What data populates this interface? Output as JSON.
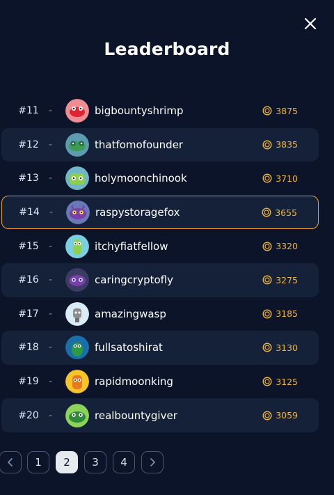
{
  "modal": {
    "title": "Leaderboard"
  },
  "colors": {
    "background": "#0b1428",
    "row_alt": "#152039",
    "highlight": "#f0a12a",
    "score": "#f2b63a"
  },
  "icons": {
    "close": "close-icon",
    "coin": "coin-icon",
    "prev": "chevron-left-icon",
    "next": "chevron-right-icon"
  },
  "entries": [
    {
      "rank": "#11",
      "dash": "-",
      "name": "bigbountyshrimp",
      "score": "3875"
    },
    {
      "rank": "#12",
      "dash": "-",
      "name": "thatfomofounder",
      "score": "3835"
    },
    {
      "rank": "#13",
      "dash": "-",
      "name": "holymoonchinook",
      "score": "3710"
    },
    {
      "rank": "#14",
      "dash": "-",
      "name": "raspystoragefox",
      "score": "3655"
    },
    {
      "rank": "#15",
      "dash": "-",
      "name": "itchyfiatfellow",
      "score": "3320"
    },
    {
      "rank": "#16",
      "dash": "-",
      "name": "caringcryptofly",
      "score": "3275"
    },
    {
      "rank": "#17",
      "dash": "-",
      "name": "amazingwasp",
      "score": "3185"
    },
    {
      "rank": "#18",
      "dash": "-",
      "name": "fullsatoshirat",
      "score": "3130"
    },
    {
      "rank": "#19",
      "dash": "-",
      "name": "rapidmoonking",
      "score": "3125"
    },
    {
      "rank": "#20",
      "dash": "-",
      "name": "realbountygiver",
      "score": "3059"
    }
  ],
  "highlighted_rank": "#14",
  "pagination": {
    "pages": [
      "1",
      "2",
      "3",
      "4"
    ],
    "current": "2"
  }
}
